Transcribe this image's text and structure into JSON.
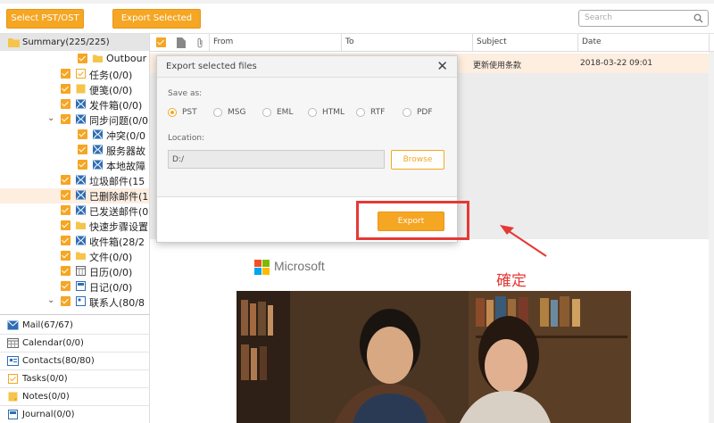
{
  "toolbar": {
    "select_pst_label": "Select PST/OST",
    "export_selected_label": "Export Selected",
    "search_placeholder": "Search"
  },
  "tree": {
    "summary": "Summary(225/225)",
    "items": [
      {
        "label": "Outbour",
        "icon": "folder-icon"
      },
      {
        "label": "任务(0/0)",
        "icon": "tasks-icon"
      },
      {
        "label": "便笺(0/0)",
        "icon": "notes-icon"
      },
      {
        "label": "发件箱(0/0)",
        "icon": "mail-icon"
      },
      {
        "label": "同步问题(0/0",
        "icon": "mail-icon"
      },
      {
        "label": "冲突(0/0",
        "icon": "mail-icon"
      },
      {
        "label": "服务器故",
        "icon": "mail-icon"
      },
      {
        "label": "本地故障",
        "icon": "mail-icon"
      },
      {
        "label": "垃圾邮件(15",
        "icon": "mail-icon"
      },
      {
        "label": "已删除邮件(1",
        "icon": "mail-icon"
      },
      {
        "label": "已发送邮件(0",
        "icon": "mail-icon"
      },
      {
        "label": "快速步骤设置",
        "icon": "folder-icon"
      },
      {
        "label": "收件箱(28/2",
        "icon": "mail-icon"
      },
      {
        "label": "文件(0/0)",
        "icon": "folder-icon"
      },
      {
        "label": "日历(0/0)",
        "icon": "calendar-icon"
      },
      {
        "label": "日记(0/0)",
        "icon": "journal-icon"
      },
      {
        "label": "联系人(80/8",
        "icon": "contacts-icon"
      }
    ]
  },
  "bottom_nav": [
    {
      "label": "Mail(67/67)"
    },
    {
      "label": "Calendar(0/0)"
    },
    {
      "label": "Contacts(80/80)"
    },
    {
      "label": "Tasks(0/0)"
    },
    {
      "label": "Notes(0/0)"
    },
    {
      "label": "Journal(0/0)"
    }
  ],
  "table": {
    "headers": {
      "from": "From",
      "to": "To",
      "subject": "Subject",
      "date": "Date"
    },
    "row": {
      "subject": "更新使用条款",
      "date": "2018-03-22 09:01"
    }
  },
  "dialog": {
    "title": "Export selected files",
    "save_as_label": "Save as:",
    "formats": [
      "PST",
      "MSG",
      "EML",
      "HTML",
      "RTF",
      "PDF"
    ],
    "selected_format": "PST",
    "location_label": "Location:",
    "location_value": "D:/",
    "browse_label": "Browse",
    "export_label": "Export"
  },
  "preview": {
    "brand": "Microsoft"
  },
  "annotation": {
    "text": "確定",
    "color": "#e53935"
  },
  "colors": {
    "accent": "#f5a623",
    "selected_row": "#fdeee0"
  }
}
